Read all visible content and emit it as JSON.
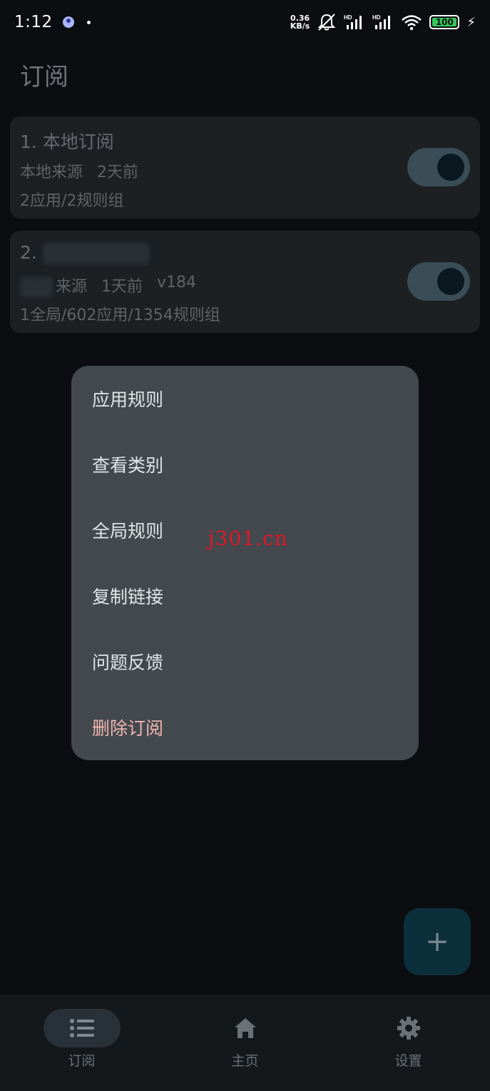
{
  "status_bar": {
    "time": "1:12",
    "net_speed_value": "0.36",
    "net_speed_unit": "KB/s",
    "battery": "100"
  },
  "page": {
    "title": "订阅"
  },
  "subscriptions": [
    {
      "index_title": "1. 本地订阅",
      "source": "本地来源",
      "updated": "2天前",
      "version": "",
      "stats": "2应用/2规则组",
      "enabled": true
    },
    {
      "index_title": "2.",
      "source": "来源",
      "updated": "1天前",
      "version": "v184",
      "stats": "1全局/602应用/1354规则组",
      "enabled": true
    }
  ],
  "menu": {
    "items": [
      "应用规则",
      "查看类别",
      "全局规则",
      "复制链接",
      "问题反馈"
    ],
    "danger_item": "删除订阅"
  },
  "watermark": "j301.cn",
  "fab": {
    "icon": "plus-icon"
  },
  "bottom_nav": [
    {
      "label": "订阅",
      "icon": "list-icon",
      "active": true
    },
    {
      "label": "主页",
      "icon": "home-icon",
      "active": false
    },
    {
      "label": "设置",
      "icon": "gear-icon",
      "active": false
    }
  ],
  "colors": {
    "background": "#0b0d10",
    "card": "#1c2023",
    "menu": "#43494d",
    "danger": "#f2b6b3",
    "watermark": "#e0162a"
  }
}
